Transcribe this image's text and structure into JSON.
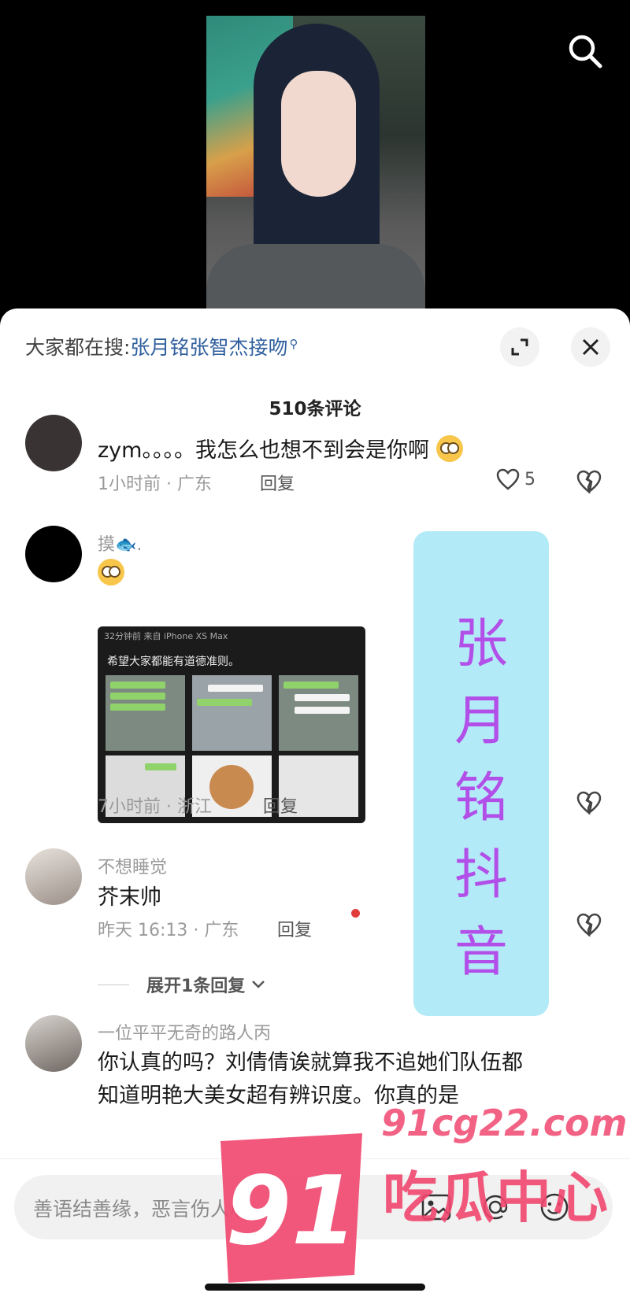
{
  "header": {
    "hot_search_prefix": "大家都在搜:",
    "hot_search_keyword": "张月铭张智杰接吻",
    "comment_count": "510条评论"
  },
  "comments": [
    {
      "username": "",
      "text": "zym。。。。我怎么也想不到会是你啊",
      "time_location": "1小时前 · 广东",
      "reply_label": "回复",
      "like_count": "5"
    },
    {
      "username": "摸🐟.",
      "time_location": "7小时前 · 浙江",
      "reply_label": "回复",
      "screenshot": {
        "header_line": "32分钟前  来自 iPhone XS Max",
        "caption": "希望大家都能有道德准则。"
      }
    },
    {
      "username": "不想睡觉",
      "text": "芥末帅",
      "time_location": "昨天 16:13 · 广东",
      "reply_label": "回复",
      "expand_replies": "展开1条回复"
    },
    {
      "username": "一位平平无奇的路人丙",
      "text_line1": "你认真的吗？刘倩倩诶就算我不追她们队伍都",
      "text_line2": "知道明艳大美女超有辨识度。你真的是"
    }
  ],
  "banner": {
    "lines": [
      "张",
      "月",
      "铭",
      "抖",
      "音"
    ]
  },
  "input": {
    "placeholder": "善语结善缘，恶言伤人心"
  },
  "watermark": {
    "number": "91",
    "url": "91cg22.com",
    "name": "吃瓜中心"
  },
  "colors": {
    "keyword": "#2f5f9e",
    "banner_bg": "#b3eaf7",
    "banner_text": "#b24fe8",
    "watermark": "#f0466e"
  }
}
